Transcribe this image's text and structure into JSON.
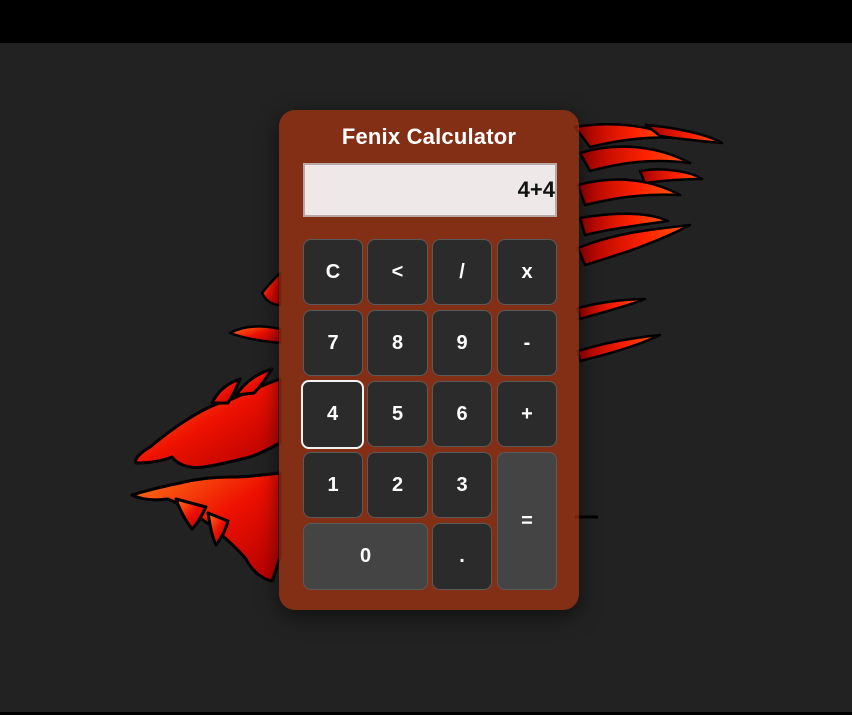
{
  "title": "Fenix Calculator",
  "display": {
    "value": "4+4"
  },
  "keys": {
    "clear": "C",
    "backspace": "<",
    "divide": "/",
    "multiply": "x",
    "seven": "7",
    "eight": "8",
    "nine": "9",
    "minus": "-",
    "four": "4",
    "five": "5",
    "six": "6",
    "plus": "+",
    "one": "1",
    "two": "2",
    "three": "3",
    "equals": "=",
    "zero": "0",
    "decimal": "."
  },
  "colors": {
    "background": "#222222",
    "panel": "#be370f",
    "key": "#2b2b2b",
    "key_light": "#444444",
    "display": "#efe8e8"
  }
}
